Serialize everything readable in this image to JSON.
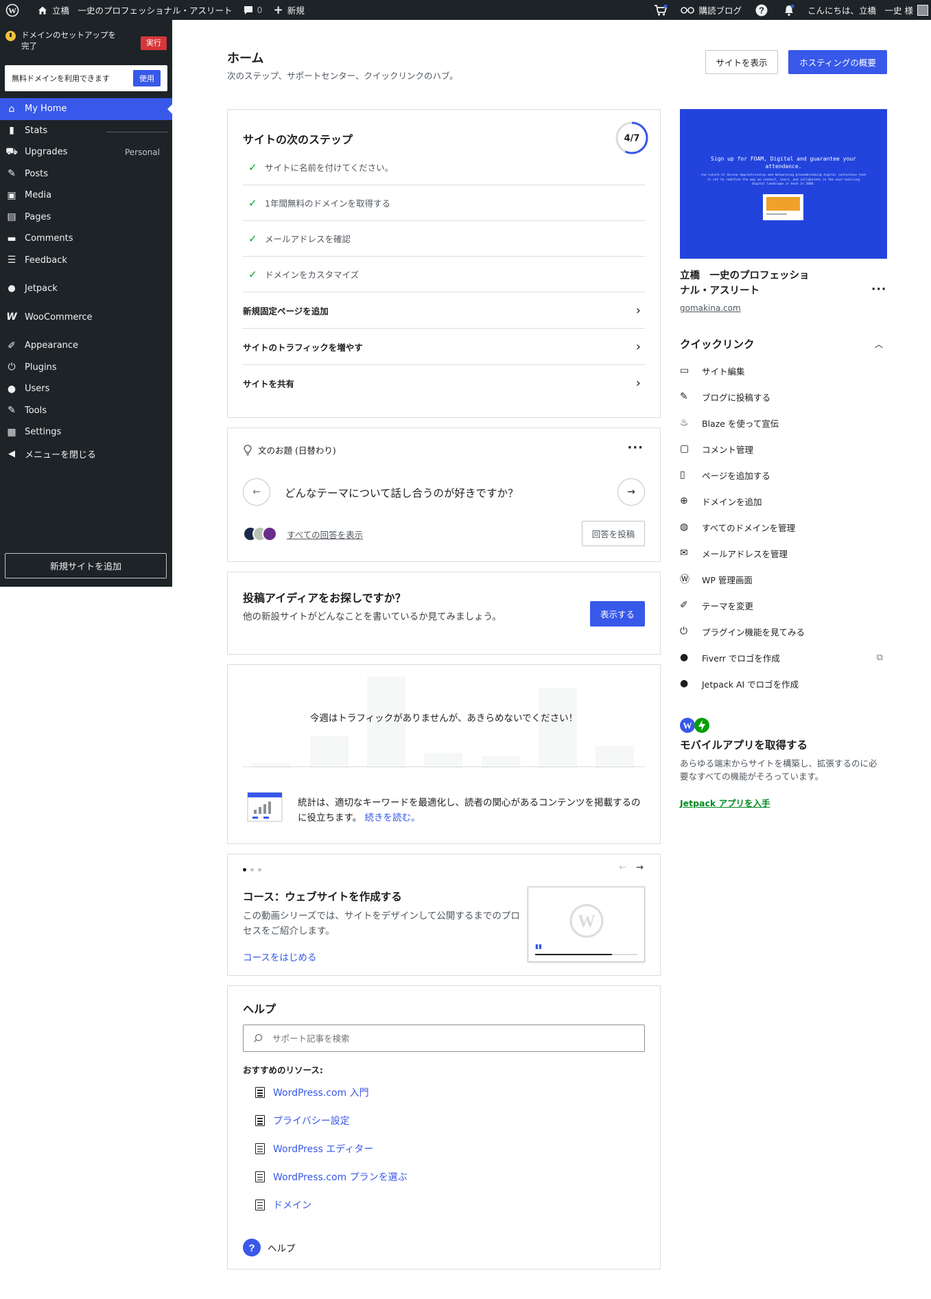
{
  "adminbar": {
    "site_name": "立橋　一史のプロフェッショナル・アスリート",
    "comments_count": "0",
    "new_label": "新規",
    "reader_label": "購読ブログ",
    "greeting": "こんにちは、立橋　一史 様"
  },
  "sidebar": {
    "notice": "ドメインのセットアップを完了",
    "notice_action": "実行",
    "free_domain": "無料ドメインを利用できます",
    "free_domain_action": "使用",
    "items": [
      {
        "label": "My Home",
        "icon": "home-icon"
      },
      {
        "label": "Stats",
        "icon": "stats-icon"
      },
      {
        "label": "Upgrades",
        "icon": "cart-icon",
        "extra": "Personal"
      },
      {
        "label": "Posts",
        "icon": "pin-icon"
      },
      {
        "label": "Media",
        "icon": "media-icon"
      },
      {
        "label": "Pages",
        "icon": "pages-icon"
      },
      {
        "label": "Comments",
        "icon": "comments-icon"
      },
      {
        "label": "Feedback",
        "icon": "feedback-icon"
      },
      {
        "label": "Jetpack",
        "icon": "jetpack-icon"
      },
      {
        "label": "WooCommerce",
        "icon": "woo-icon"
      },
      {
        "label": "Appearance",
        "icon": "brush-icon"
      },
      {
        "label": "Plugins",
        "icon": "plug-icon"
      },
      {
        "label": "Users",
        "icon": "user-icon"
      },
      {
        "label": "Tools",
        "icon": "wrench-icon"
      },
      {
        "label": "Settings",
        "icon": "settings-icon"
      },
      {
        "label": "メニューを閉じる",
        "icon": "collapse-icon"
      }
    ],
    "add_site": "新規サイトを追加"
  },
  "header": {
    "title": "ホーム",
    "subtitle": "次のステップ、サポートセンター、クイックリンクのハブ。",
    "view_site": "サイトを表示",
    "hosting": "ホスティングの概要"
  },
  "steps": {
    "title": "サイトの次のステップ",
    "progress": "4/7",
    "progress_fraction": 0.571,
    "done": [
      "サイトに名前を付けてください。",
      "1年間無料のドメインを取得する",
      "メールアドレスを確認",
      "ドメインをカスタマイズ"
    ],
    "links": [
      "新規固定ページを追加",
      "サイトのトラフィックを増やす",
      "サイトを共有"
    ]
  },
  "prompt": {
    "label": "文のお題 (日替わり)",
    "question": "どんなテーマについて話し合うのが好きですか？",
    "all_answers": "すべての回答を表示",
    "post_answer": "回答を投稿"
  },
  "ideas": {
    "title": "投稿アイディアをお探しですか？",
    "text": "他の新設サイトがどんなことを書いているか見てみましょう。",
    "button": "表示する"
  },
  "traffic": {
    "message": "今週はトラフィックがありませんが、あきらめないでください！",
    "stats_text": "統計は、適切なキーワードを最適化し、読者の関心があるコンテンツを掲載するのに役立ちます。",
    "read_more": "続きを読む。"
  },
  "course": {
    "title": "コース：ウェブサイトを作成する",
    "text": "この動画シリーズでは、サイトをデザインして公開するまでのプロセスをご紹介します。",
    "link": "コースをはじめる"
  },
  "help": {
    "title": "ヘルプ",
    "search_placeholder": "サポート記事を検索",
    "resources_label": "おすすめのリソース:",
    "resources": [
      "WordPress.com 入門",
      "プライバシー設定",
      "WordPress エディター",
      "WordPress.com プランを選ぶ",
      "ドメイン"
    ],
    "help_button": "ヘルプ"
  },
  "site_card": {
    "preview_line1": "Sign up for FOAM, Digital and guarantee your attendance.",
    "preview_line2": "The Future of Online Apprenticeship and Networking groundbreaking digital conference that is set to redefine the way we connect, learn, and collaborate in the ever-evolving digital landscape is back in 2060.",
    "name": "立橋　一史のプロフェッショナル・アスリート",
    "url": "gomakina.com"
  },
  "quicklinks": {
    "title": "クイックリンク",
    "items": [
      {
        "label": "サイト編集",
        "icon": "laptop-icon"
      },
      {
        "label": "ブログに投稿する",
        "icon": "pencil-icon"
      },
      {
        "label": "Blaze を使って宣伝",
        "icon": "flame-icon"
      },
      {
        "label": "コメント管理",
        "icon": "comment-icon"
      },
      {
        "label": "ページを追加する",
        "icon": "page-icon"
      },
      {
        "label": "ドメインを追加",
        "icon": "plus-circle-icon"
      },
      {
        "label": "すべてのドメインを管理",
        "icon": "globe-icon"
      },
      {
        "label": "メールアドレスを管理",
        "icon": "mail-icon"
      },
      {
        "label": "WP 管理画面",
        "icon": "wordpress-icon"
      },
      {
        "label": "テーマを変更",
        "icon": "brush-icon"
      },
      {
        "label": "プラグイン機能を見てみる",
        "icon": "plug-icon"
      },
      {
        "label": "Fiverr でロゴを作成",
        "icon": "fiverr-icon"
      },
      {
        "label": "Jetpack AI でロゴを作成",
        "icon": "jetpack-icon"
      }
    ]
  },
  "mobile": {
    "title": "モバイルアプリを取得する",
    "text": "あらゆる端末からサイトを構築し、拡張するのに必要なすべての機能がそろっています。",
    "link": "Jetpack アプリを入手"
  },
  "colors": {
    "accent": "#3858e9",
    "sidebar": "#1d2327",
    "success": "#00a32a",
    "alert": "#d63638"
  }
}
